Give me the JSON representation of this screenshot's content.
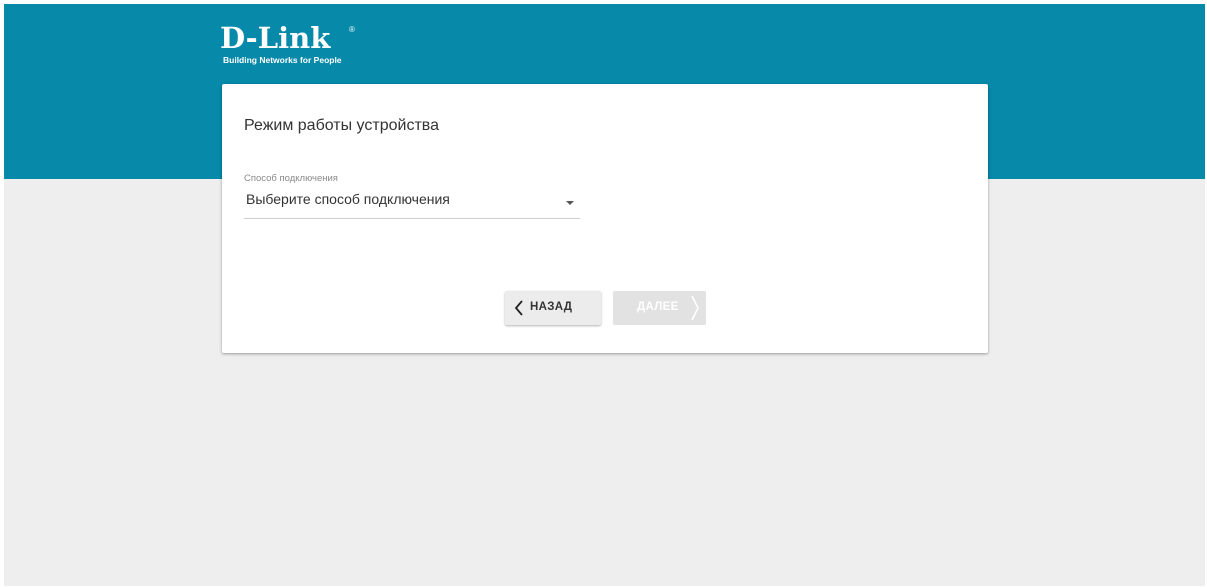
{
  "header": {
    "logo_text": "D-Link",
    "logo_reg_mark": "®",
    "logo_tagline": "Building Networks for People"
  },
  "card": {
    "title": "Режим работы устройства",
    "connection_field": {
      "label": "Способ подключения",
      "value": "Выберите способ подключения"
    }
  },
  "buttons": {
    "back_label": "НАЗАД",
    "next_label": "ДАЛЕЕ"
  },
  "icons": {
    "back": "chevron-left-icon",
    "next": "chevron-right-icon",
    "dropdown": "caret-down-icon"
  },
  "colors": {
    "header_band": "#0789a9",
    "page_background": "#eeeeee",
    "card_background": "#ffffff",
    "button_back_background": "#ececec",
    "button_next_disabled_background": "#e2e2e2"
  }
}
